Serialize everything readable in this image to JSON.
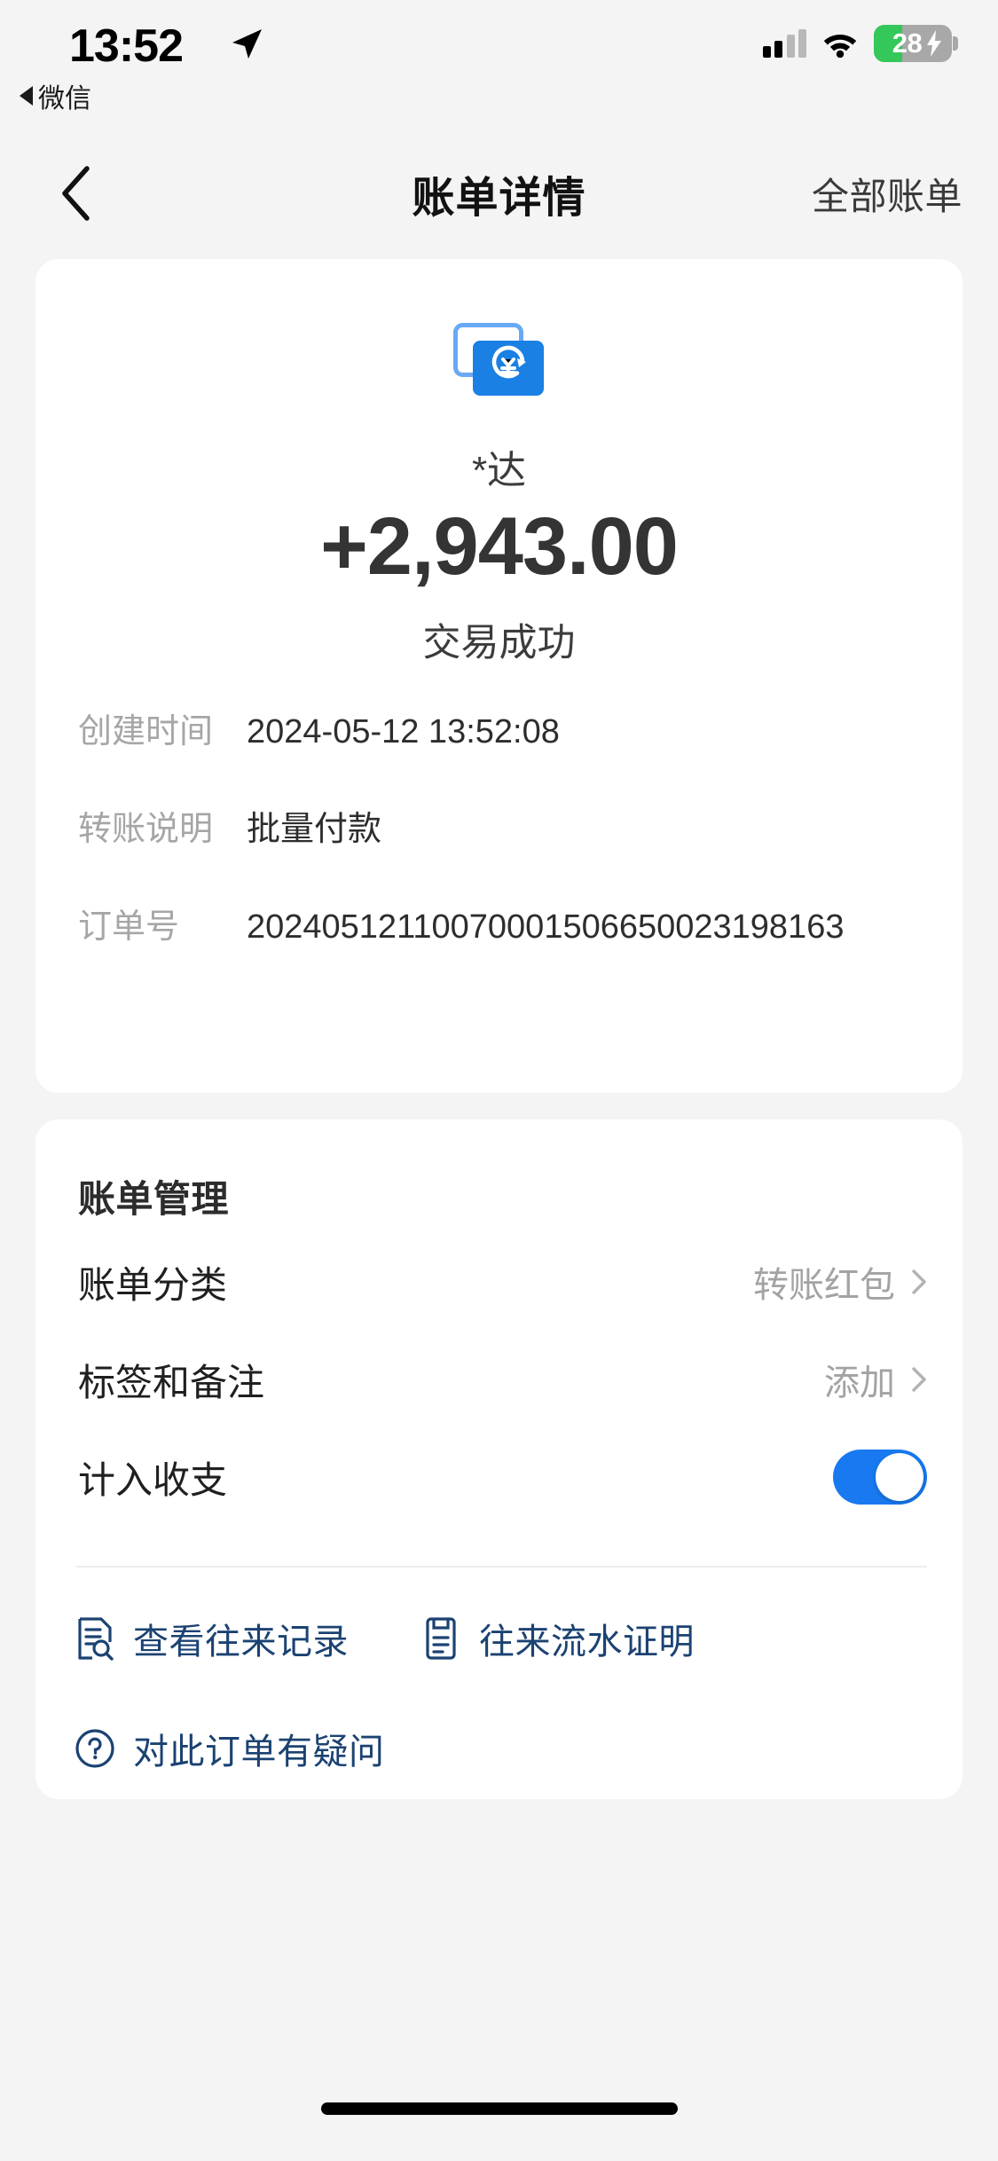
{
  "status_bar": {
    "time": "13:52",
    "return_app": "微信",
    "battery_level": "28",
    "battery_color": "#34c759",
    "icons": [
      "location-arrow-icon",
      "cellular-signal-icon",
      "wifi-icon",
      "battery-icon",
      "charging-bolt-icon"
    ]
  },
  "nav": {
    "back_icon": "chevron-left-icon",
    "title": "账单详情",
    "action": "全部账单"
  },
  "detail": {
    "icon": "transfer-cards-icon",
    "payee": "*达",
    "amount": "+2,943.00",
    "status": "交易成功",
    "rows": [
      {
        "label": "创建时间",
        "value": "2024-05-12 13:52:08"
      },
      {
        "label": "转账说明",
        "value": "批量付款"
      },
      {
        "label": "订单号",
        "value": "20240512110070001506650023198163"
      }
    ]
  },
  "manage": {
    "title": "账单管理",
    "category": {
      "label": "账单分类",
      "value": "转账红包",
      "chevron": "chevron-right-icon"
    },
    "tag": {
      "label": "标签和备注",
      "value": "添加",
      "chevron": "chevron-right-icon"
    },
    "count": {
      "label": "计入收支",
      "toggle_on": true
    },
    "links": [
      {
        "label": "查看往来记录",
        "icon": "document-search-icon"
      },
      {
        "label": "往来流水证明",
        "icon": "document-lines-icon"
      },
      {
        "label": "对此订单有疑问",
        "icon": "question-circle-icon"
      }
    ]
  },
  "colors": {
    "page_background": "#f4f4f4",
    "card_background": "#ffffff",
    "accent_blue": "#1879f0",
    "link_navy": "#1b4272",
    "muted_text": "#a6a6a6"
  }
}
